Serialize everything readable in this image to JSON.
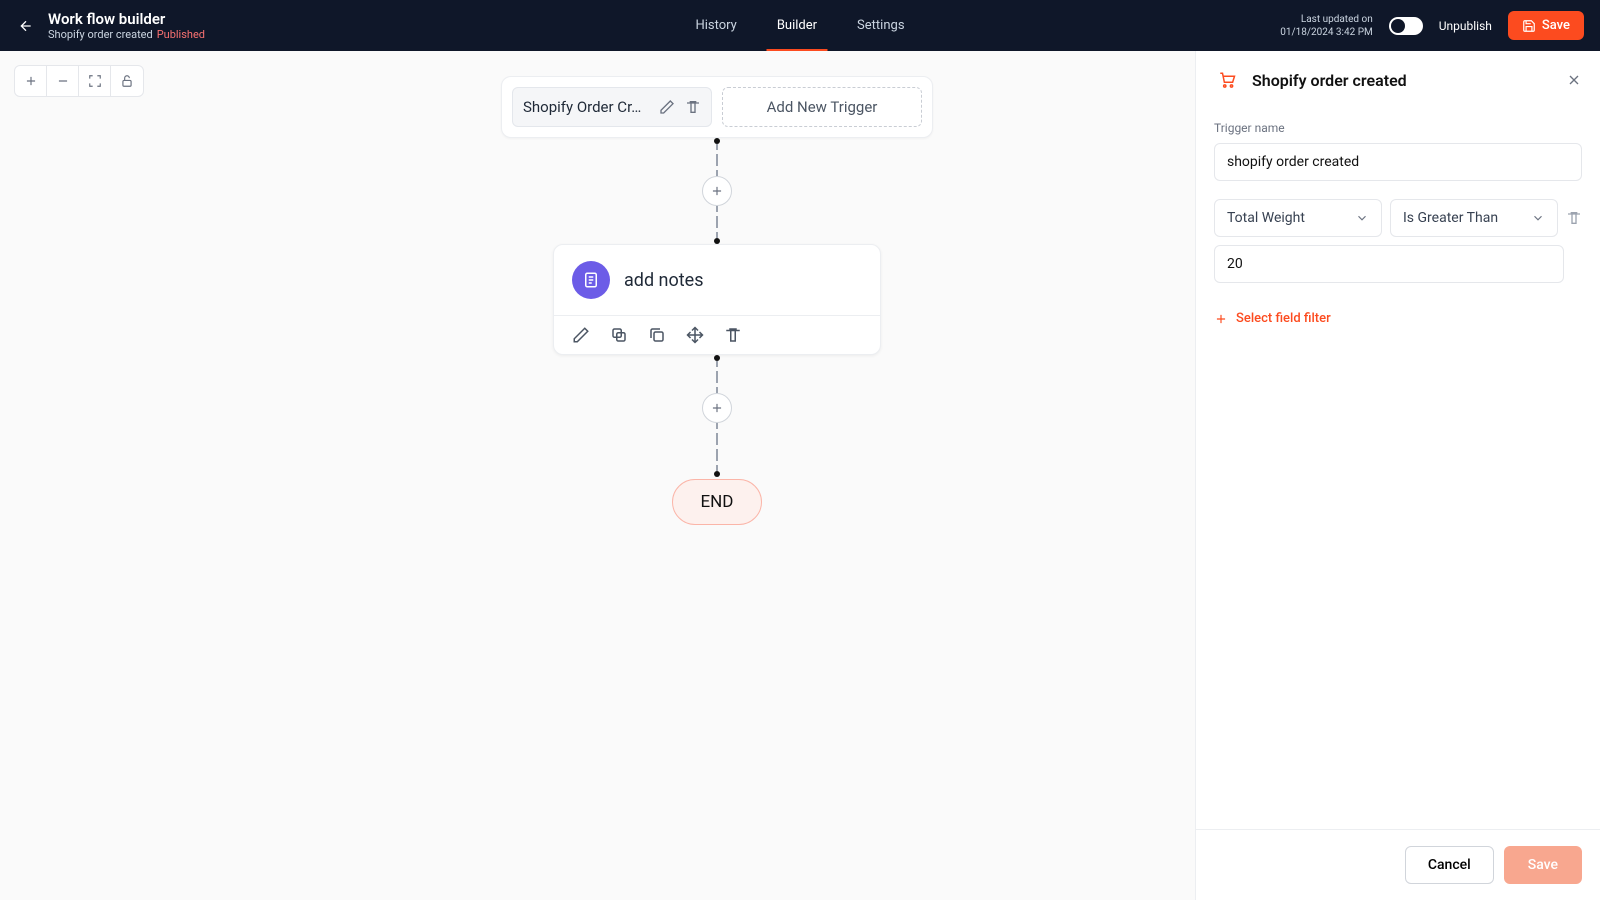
{
  "header": {
    "title": "Work flow builder",
    "subtitle": "Shopify order created",
    "status": "Published",
    "nav": [
      "History",
      "Builder",
      "Settings"
    ],
    "active_nav": 1,
    "updated_label": "Last updated on",
    "updated_value": "01/18/2024 3:42 PM",
    "unpublish": "Unpublish",
    "save": "Save"
  },
  "flow": {
    "trigger_label": "Shopify Order Cr…",
    "add_trigger": "Add New Trigger",
    "node_title": "add notes",
    "end": "END"
  },
  "panel": {
    "title": "Shopify order created",
    "trigger_name_label": "Trigger name",
    "trigger_name_value": "shopify order created",
    "filter_field": "Total Weight",
    "filter_op": "Is Greater Than",
    "filter_value": "20",
    "add_filter": "Select field filter",
    "cancel": "Cancel",
    "save": "Save"
  }
}
